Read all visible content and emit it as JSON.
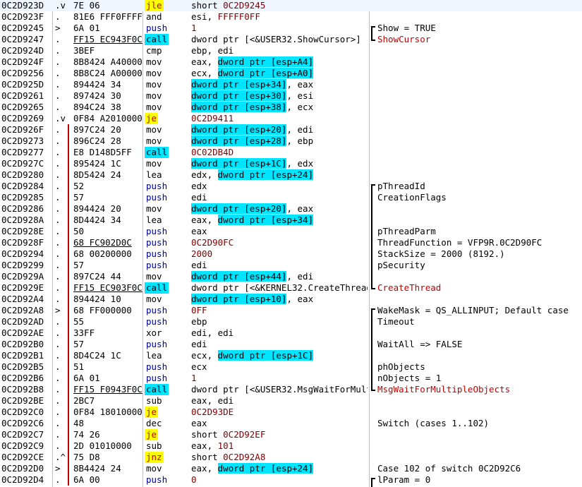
{
  "listing": {
    "rows": [
      {
        "addr": "0C2D923D",
        "mark": ".v",
        "hex": "7E 06",
        "mn": "jle",
        "mt": "jcc",
        "ops": [
          {
            "t": "short "
          },
          {
            "t": "0C2D9245",
            "cls": "num"
          }
        ],
        "cmt": "",
        "cc": "",
        "br": ""
      },
      {
        "addr": "0C2D923F",
        "mark": ".",
        "hex": "81E6 FFF0FFFF",
        "mn": "and",
        "mt": "plain",
        "ops": [
          {
            "t": "esi, "
          },
          {
            "t": "FFFFF0FF",
            "cls": "num"
          }
        ],
        "cmt": "",
        "cc": "",
        "br": ""
      },
      {
        "addr": "0C2D9245",
        "mark": ">",
        "hex": "6A 01",
        "mn": "push",
        "mt": "push",
        "ops": [
          {
            "t": "1",
            "cls": "num"
          }
        ],
        "cmt": "Show = TRUE",
        "cc": "",
        "br": "top"
      },
      {
        "addr": "0C2D9247",
        "mark": ".",
        "hex": "FF15 EC943F0C",
        "hexU": true,
        "mn": "call",
        "mt": "call",
        "ops": [
          {
            "t": "dword ptr [<&USER32.ShowCursor>]"
          }
        ],
        "cmt": "ShowCursor",
        "cc": "red",
        "br": "bot"
      },
      {
        "addr": "0C2D924D",
        "mark": ".",
        "hex": "3BEF",
        "mn": "cmp",
        "mt": "plain",
        "ops": [
          {
            "t": "ebp, edi"
          }
        ],
        "cmt": "",
        "cc": "",
        "br": ""
      },
      {
        "addr": "0C2D924F",
        "mark": ".",
        "hex": "8B8424 A4000000",
        "mn": "mov",
        "mt": "plain",
        "ops": [
          {
            "t": "eax, "
          },
          {
            "t": "dword ptr [esp+A4]",
            "cls": "hl"
          }
        ],
        "cmt": "",
        "cc": "",
        "br": ""
      },
      {
        "addr": "0C2D9256",
        "mark": ".",
        "hex": "8B8C24 A0000000",
        "mn": "mov",
        "mt": "plain",
        "ops": [
          {
            "t": "ecx, "
          },
          {
            "t": "dword ptr [esp+A0]",
            "cls": "hl"
          }
        ],
        "cmt": "",
        "cc": "",
        "br": ""
      },
      {
        "addr": "0C2D925D",
        "mark": ".",
        "hex": "894424 34",
        "mn": "mov",
        "mt": "plain",
        "ops": [
          {
            "t": "dword ptr [esp+34]",
            "cls": "hl"
          },
          {
            "t": ", eax"
          }
        ],
        "cmt": "",
        "cc": "",
        "br": ""
      },
      {
        "addr": "0C2D9261",
        "mark": ".",
        "hex": "897424 30",
        "mn": "mov",
        "mt": "plain",
        "ops": [
          {
            "t": "dword ptr [esp+30]",
            "cls": "hl"
          },
          {
            "t": ", esi"
          }
        ],
        "cmt": "",
        "cc": "",
        "br": ""
      },
      {
        "addr": "0C2D9265",
        "mark": ".",
        "hex": "894C24 38",
        "mn": "mov",
        "mt": "plain",
        "ops": [
          {
            "t": "dword ptr [esp+38]",
            "cls": "hl"
          },
          {
            "t": ", ecx"
          }
        ],
        "cmt": "",
        "cc": "",
        "br": ""
      },
      {
        "addr": "0C2D9269",
        "mark": ".v",
        "hex": "0F84 A2010000",
        "mn": "je",
        "mt": "jcc",
        "ops": [
          {
            "t": "0C2D9411",
            "cls": "num"
          }
        ],
        "cmt": "",
        "cc": "",
        "br": ""
      },
      {
        "addr": "0C2D926F",
        "mark": ".",
        "hex": "897C24 20",
        "mn": "mov",
        "mt": "plain",
        "ops": [
          {
            "t": "dword ptr [esp+20]",
            "cls": "hl"
          },
          {
            "t": ", edi"
          }
        ],
        "cmt": "",
        "cc": "",
        "br": "",
        "j": true
      },
      {
        "addr": "0C2D9273",
        "mark": ".",
        "hex": "896C24 28",
        "mn": "mov",
        "mt": "plain",
        "ops": [
          {
            "t": "dword ptr [esp+28]",
            "cls": "hl"
          },
          {
            "t": ", ebp"
          }
        ],
        "cmt": "",
        "cc": "",
        "br": "",
        "j": true
      },
      {
        "addr": "0C2D9277",
        "mark": ".",
        "hex": "E8 D148D5FF",
        "mn": "call",
        "mt": "call",
        "ops": [
          {
            "t": "0C02DB4D",
            "cls": "num"
          }
        ],
        "cmt": "",
        "cc": "",
        "br": "",
        "j": true
      },
      {
        "addr": "0C2D927C",
        "mark": ".",
        "hex": "895424 1C",
        "mn": "mov",
        "mt": "plain",
        "ops": [
          {
            "t": "dword ptr [esp+1C]",
            "cls": "hl"
          },
          {
            "t": ", edx"
          }
        ],
        "cmt": "",
        "cc": "",
        "br": "",
        "j": true
      },
      {
        "addr": "0C2D9280",
        "mark": ".",
        "hex": "8D5424 24",
        "mn": "lea",
        "mt": "plain",
        "ops": [
          {
            "t": "edx, "
          },
          {
            "t": "dword ptr [esp+24]",
            "cls": "hl"
          }
        ],
        "cmt": "",
        "cc": "",
        "br": "",
        "j": true
      },
      {
        "addr": "0C2D9284",
        "mark": ".",
        "hex": "52",
        "mn": "push",
        "mt": "push",
        "ops": [
          {
            "t": "edx"
          }
        ],
        "cmt": "pThreadId",
        "cc": "",
        "br": "top",
        "j": true
      },
      {
        "addr": "0C2D9285",
        "mark": ".",
        "hex": "57",
        "mn": "push",
        "mt": "push",
        "ops": [
          {
            "t": "edi"
          }
        ],
        "cmt": "CreationFlags",
        "cc": "",
        "br": "mid",
        "j": true
      },
      {
        "addr": "0C2D9286",
        "mark": ".",
        "hex": "894424 20",
        "mn": "mov",
        "mt": "plain",
        "ops": [
          {
            "t": "dword ptr [esp+20]",
            "cls": "hl"
          },
          {
            "t": ", eax"
          }
        ],
        "cmt": "",
        "cc": "",
        "br": "mid",
        "j": true
      },
      {
        "addr": "0C2D928A",
        "mark": ".",
        "hex": "8D4424 34",
        "mn": "lea",
        "mt": "plain",
        "ops": [
          {
            "t": "eax, "
          },
          {
            "t": "dword ptr [esp+34]",
            "cls": "hl"
          }
        ],
        "cmt": "",
        "cc": "",
        "br": "mid",
        "j": true
      },
      {
        "addr": "0C2D928E",
        "mark": ".",
        "hex": "50",
        "mn": "push",
        "mt": "push",
        "ops": [
          {
            "t": "eax"
          }
        ],
        "cmt": "pThreadParm",
        "cc": "",
        "br": "mid",
        "j": true
      },
      {
        "addr": "0C2D928F",
        "mark": ".",
        "hex": "68 FC902D0C",
        "hexU": true,
        "mn": "push",
        "mt": "push",
        "ops": [
          {
            "t": "0C2D90FC",
            "cls": "num"
          }
        ],
        "cmt": "ThreadFunction = VFP9R.0C2D90FC",
        "cc": "",
        "br": "mid",
        "j": true
      },
      {
        "addr": "0C2D9294",
        "mark": ".",
        "hex": "68 00200000",
        "mn": "push",
        "mt": "push",
        "ops": [
          {
            "t": "2000",
            "cls": "num"
          }
        ],
        "cmt": "StackSize = 2000 (8192.)",
        "cc": "",
        "br": "mid",
        "j": true
      },
      {
        "addr": "0C2D9299",
        "mark": ".",
        "hex": "57",
        "mn": "push",
        "mt": "push",
        "ops": [
          {
            "t": "edi"
          }
        ],
        "cmt": "pSecurity",
        "cc": "",
        "br": "mid",
        "j": true
      },
      {
        "addr": "0C2D929A",
        "mark": ".",
        "hex": "897C24 44",
        "mn": "mov",
        "mt": "plain",
        "ops": [
          {
            "t": "dword ptr [esp+44]",
            "cls": "hl"
          },
          {
            "t": ", edi"
          }
        ],
        "cmt": "",
        "cc": "",
        "br": "mid",
        "j": true
      },
      {
        "addr": "0C2D929E",
        "mark": ".",
        "hex": "FF15 EC903F0C",
        "hexU": true,
        "mn": "call",
        "mt": "call",
        "ops": [
          {
            "t": "dword ptr [<&KERNEL32.CreateThread>]"
          }
        ],
        "cmt": "CreateThread",
        "cc": "red",
        "br": "bot",
        "j": true
      },
      {
        "addr": "0C2D92A4",
        "mark": ".",
        "hex": "894424 10",
        "mn": "mov",
        "mt": "plain",
        "ops": [
          {
            "t": "dword ptr [esp+10]",
            "cls": "hl"
          },
          {
            "t": ", eax"
          }
        ],
        "cmt": "",
        "cc": "",
        "br": "",
        "j": true
      },
      {
        "addr": "0C2D92A8",
        "mark": ">",
        "hex": "68 FF000000",
        "mn": "push",
        "mt": "push",
        "ops": [
          {
            "t": "0FF",
            "cls": "num"
          }
        ],
        "cmt": "WakeMask = QS_ALLINPUT; Default case",
        "cc": "",
        "br": "top",
        "j": true
      },
      {
        "addr": "0C2D92AD",
        "mark": ".",
        "hex": "55",
        "mn": "push",
        "mt": "push",
        "ops": [
          {
            "t": "ebp"
          }
        ],
        "cmt": "Timeout",
        "cc": "",
        "br": "mid",
        "j": true
      },
      {
        "addr": "0C2D92AE",
        "mark": ".",
        "hex": "33FF",
        "mn": "xor",
        "mt": "plain",
        "ops": [
          {
            "t": "edi, edi"
          }
        ],
        "cmt": "",
        "cc": "",
        "br": "mid",
        "j": true
      },
      {
        "addr": "0C2D92B0",
        "mark": ".",
        "hex": "57",
        "mn": "push",
        "mt": "push",
        "ops": [
          {
            "t": "edi"
          }
        ],
        "cmt": "WaitAll => FALSE",
        "cc": "",
        "br": "mid",
        "j": true
      },
      {
        "addr": "0C2D92B1",
        "mark": ".",
        "hex": "8D4C24 1C",
        "mn": "lea",
        "mt": "plain",
        "ops": [
          {
            "t": "ecx, "
          },
          {
            "t": "dword ptr [esp+1C]",
            "cls": "hl"
          }
        ],
        "cmt": "",
        "cc": "",
        "br": "mid",
        "j": true
      },
      {
        "addr": "0C2D92B5",
        "mark": ".",
        "hex": "51",
        "mn": "push",
        "mt": "push",
        "ops": [
          {
            "t": "ecx"
          }
        ],
        "cmt": "phObjects",
        "cc": "",
        "br": "mid",
        "j": true
      },
      {
        "addr": "0C2D92B6",
        "mark": ".",
        "hex": "6A 01",
        "mn": "push",
        "mt": "push",
        "ops": [
          {
            "t": "1",
            "cls": "num"
          }
        ],
        "cmt": "nObjects = 1",
        "cc": "",
        "br": "mid",
        "j": true
      },
      {
        "addr": "0C2D92B8",
        "mark": ".",
        "hex": "FF15 F0943F0C",
        "hexU": true,
        "mn": "call",
        "mt": "call",
        "ops": [
          {
            "t": "dword ptr [<&USER32.MsgWaitForMultipleObjects>]"
          }
        ],
        "cmt": "MsgWaitForMultipleObjects",
        "cc": "red",
        "br": "bot",
        "j": true
      },
      {
        "addr": "0C2D92BE",
        "mark": ".",
        "hex": "2BC7",
        "mn": "sub",
        "mt": "plain",
        "ops": [
          {
            "t": "eax, edi"
          }
        ],
        "cmt": "",
        "cc": "",
        "br": "",
        "j": true
      },
      {
        "addr": "0C2D92C0",
        "mark": ".",
        "hex": "0F84 18010000",
        "mn": "je",
        "mt": "jcc",
        "ops": [
          {
            "t": "0C2D93DE",
            "cls": "num"
          }
        ],
        "cmt": "",
        "cc": "",
        "br": "",
        "j": true
      },
      {
        "addr": "0C2D92C6",
        "mark": ".",
        "hex": "48",
        "mn": "dec",
        "mt": "plain",
        "ops": [
          {
            "t": "eax"
          }
        ],
        "cmt": "Switch (cases 1..102)",
        "cc": "",
        "br": "",
        "j": true
      },
      {
        "addr": "0C2D92C7",
        "mark": ".",
        "hex": "74 26",
        "mn": "je",
        "mt": "jcc",
        "ops": [
          {
            "t": "short "
          },
          {
            "t": "0C2D92EF",
            "cls": "num"
          }
        ],
        "cmt": "",
        "cc": "",
        "br": "",
        "j": true
      },
      {
        "addr": "0C2D92C9",
        "mark": ".",
        "hex": "2D 01010000",
        "mn": "sub",
        "mt": "plain",
        "ops": [
          {
            "t": "eax, "
          },
          {
            "t": "101",
            "cls": "num"
          }
        ],
        "cmt": "",
        "cc": "",
        "br": "",
        "j": true
      },
      {
        "addr": "0C2D92CE",
        "mark": ".^",
        "hex": "75 D8",
        "mn": "jnz",
        "mt": "jcc",
        "ops": [
          {
            "t": "short "
          },
          {
            "t": "0C2D92A8",
            "cls": "num"
          }
        ],
        "cmt": "",
        "cc": "",
        "br": "",
        "j": true
      },
      {
        "addr": "0C2D92D0",
        "mark": ">",
        "hex": "8B4424 24",
        "mn": "mov",
        "mt": "plain",
        "ops": [
          {
            "t": "eax, "
          },
          {
            "t": "dword ptr [esp+24]",
            "cls": "hl"
          }
        ],
        "cmt": "Case 102 of switch 0C2D92C6",
        "cc": "",
        "br": "",
        "j": true
      },
      {
        "addr": "0C2D92D4",
        "mark": ".",
        "hex": "6A 00",
        "mn": "push",
        "mt": "push",
        "ops": [
          {
            "t": "0",
            "cls": "num"
          }
        ],
        "cmt": "lParam = 0",
        "cc": "",
        "br": "top",
        "j": true
      }
    ]
  }
}
